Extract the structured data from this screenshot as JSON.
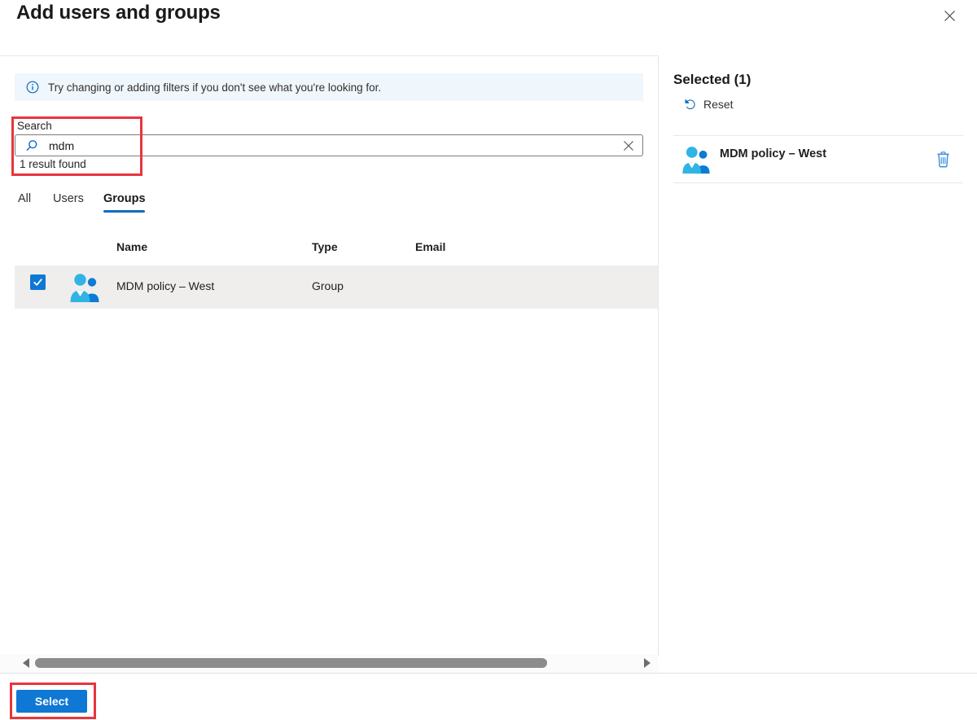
{
  "header": {
    "title": "Add users and groups"
  },
  "banner": {
    "text": "Try changing or adding filters if you don't see what you're looking for."
  },
  "search": {
    "label": "Search",
    "value": "mdm",
    "result_text": "1 result found"
  },
  "tabs": [
    {
      "label": "All",
      "active": false
    },
    {
      "label": "Users",
      "active": false
    },
    {
      "label": "Groups",
      "active": true
    }
  ],
  "table": {
    "columns": [
      "Name",
      "Type",
      "Email"
    ],
    "rows": [
      {
        "name": "MDM policy – West",
        "type": "Group",
        "email": "",
        "checked": true
      }
    ]
  },
  "selected_panel": {
    "title": "Selected (1)",
    "reset_label": "Reset",
    "items": [
      {
        "name": "MDM policy – West"
      }
    ]
  },
  "footer": {
    "select_label": "Select"
  },
  "colors": {
    "accent": "#0f78d4",
    "tab_underline": "#0f6cbd",
    "annotation_red": "#e8353b",
    "banner_bg": "#eff6fc",
    "row_selected_bg": "#efeeed",
    "group_icon_primary": "#2fb4e4",
    "group_icon_secondary": "#0d7bd6"
  }
}
